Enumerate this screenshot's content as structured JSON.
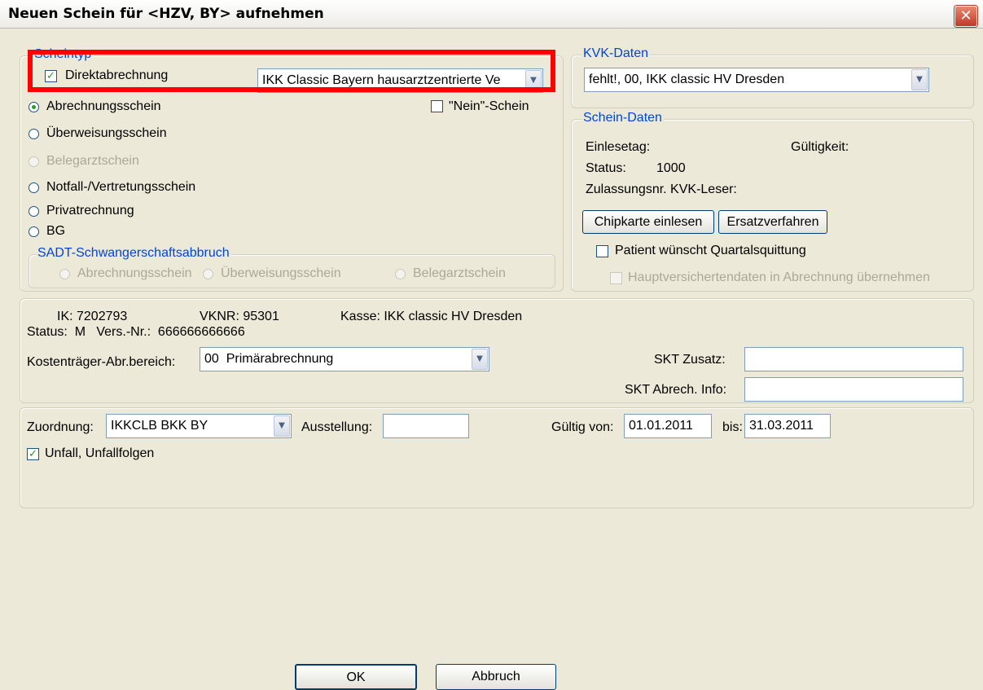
{
  "window": {
    "title": "Neuen Schein für <HZV, BY> aufnehmen",
    "close_glyph": "✕"
  },
  "scheintyp": {
    "legend": "Scheintyp",
    "direktabrechnung_label": "Direktabrechnung",
    "direktabrechnung_checked": true,
    "kasse_select": "IKK Classic Bayern hausarztzentrierte Ve",
    "nein_schein_label": "\"Nein\"-Schein",
    "options": [
      {
        "label": "Abrechnungsschein",
        "selected": true,
        "enabled": true
      },
      {
        "label": "Überweisungsschein",
        "selected": false,
        "enabled": true
      },
      {
        "label": "Belegarztschein",
        "selected": false,
        "enabled": false
      },
      {
        "label": "Notfall-/Vertretungsschein",
        "selected": false,
        "enabled": true
      },
      {
        "label": "Privatrechnung",
        "selected": false,
        "enabled": true
      },
      {
        "label": "BG",
        "selected": false,
        "enabled": true
      }
    ],
    "sadt": {
      "legend": "SADT-Schwangerschaftsabbruch",
      "options": [
        "Abrechnungsschein",
        "Überweisungsschein",
        "Belegarztschein"
      ]
    }
  },
  "kvk": {
    "legend": "KVK-Daten",
    "select": "fehlt!, 00, IKK classic HV Dresden"
  },
  "schein_daten": {
    "legend": "Schein-Daten",
    "einlesetag_label": "Einlesetag:",
    "gueltigkeit_label": "Gültigkeit:",
    "status_label": "Status:",
    "status_value": "1000",
    "zulassung_label": "Zulassungsnr. KVK-Leser:",
    "chipkarte_button": "Chipkarte einlesen",
    "ersatz_button": "Ersatzverfahren",
    "quartalsquittung_label": "Patient wünscht Quartalsquittung",
    "hauptversicherte_label": "Hauptversichertendaten in Abrechnung übernehmen"
  },
  "versicherung": {
    "ik": "IK: 7202793",
    "vknr": "VKNR: 95301",
    "kasse": "Kasse: IKK classic HV Dresden",
    "status_line": "Status:  M   Vers.-Nr.:  666666666666",
    "kostentraeger_label": "Kostenträger-Abr.bereich:",
    "kostentraeger_value": "00  Primärabrechnung",
    "skt_zusatz_label": "SKT Zusatz:",
    "skt_zusatz_value": "",
    "skt_info_label": "SKT Abrech. Info:",
    "skt_info_value": ""
  },
  "zuordnung": {
    "label": "Zuordnung:",
    "value": "IKKCLB BKK BY",
    "ausstellung_label": "Ausstellung:",
    "ausstellung_value": "",
    "gueltig_von_label": "Gültig von:",
    "gueltig_von_value": "01.01.2011",
    "bis_label": "bis:",
    "bis_value": "31.03.2011",
    "unfall_label": "Unfall, Unfallfolgen",
    "unfall_checked": true
  },
  "buttons": {
    "ok": "OK",
    "abbruch": "Abbruch"
  },
  "icons": {
    "dropdown": "▼",
    "check": "✓"
  },
  "colors": {
    "legend": "#0046d5",
    "highlight": "#ff0000",
    "check": "#21a121",
    "dialog": "#ece9d8"
  }
}
